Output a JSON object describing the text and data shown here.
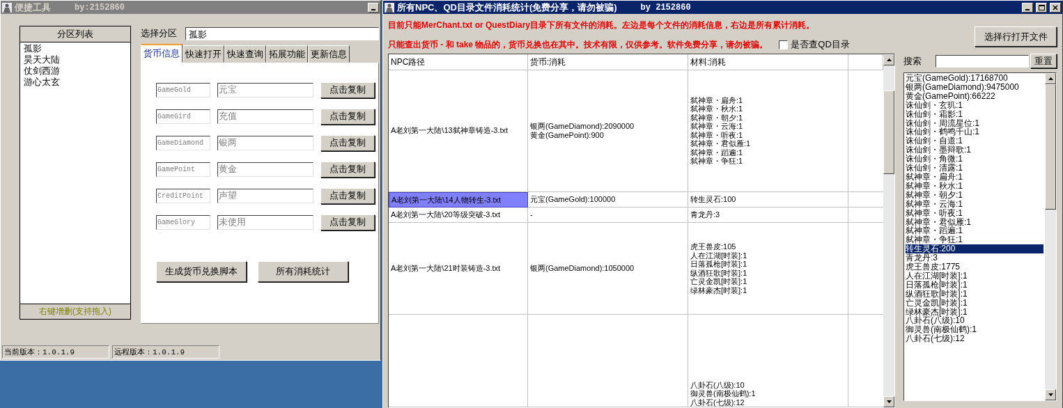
{
  "left_window": {
    "title": "便捷工具",
    "author": "by:2152860",
    "partition_list": {
      "header": "分区列表",
      "items": [
        "孤影",
        "昊天大陆",
        "仗剑西游",
        "游心太玄"
      ],
      "footer": "右键增删(支持拖入)"
    },
    "select_label": "选择分区",
    "select_value": "孤影",
    "tabs": [
      {
        "label": "货币信息",
        "selected": true
      },
      {
        "label": "快速打开",
        "selected": false
      },
      {
        "label": "快速查询",
        "selected": false
      },
      {
        "label": "拓展功能",
        "selected": false
      },
      {
        "label": "更新信息",
        "selected": false
      }
    ],
    "currency_rows": [
      {
        "code": "GameGold",
        "name": "元宝",
        "button": "点击复制"
      },
      {
        "code": "GameGird",
        "name": "充值",
        "button": "点击复制"
      },
      {
        "code": "GameDiamond",
        "name": "银两",
        "button": "点击复制"
      },
      {
        "code": "GamePoint",
        "name": "黄金",
        "button": "点击复制"
      },
      {
        "code": "CreditPoint",
        "name": "声望",
        "button": "点击复制"
      },
      {
        "code": "GameGlory",
        "name": "未使用",
        "button": "点击复制"
      }
    ],
    "action_buttons": [
      "生成货币兑换脚本",
      "所有消耗统计"
    ],
    "status_bar": [
      "当前版本：1.0.1.9",
      "远程版本：1.0.1.9"
    ]
  },
  "right_window": {
    "title": "所有NPC、QD目录文件消耗统计(免费分享，请勿被骗)",
    "author": "by 2152860",
    "notice_lines": [
      "目前只能MerChant.txt or QuestDiary目录下所有文件的消耗。左边是每个文件的消耗信息，右边是所有累计消耗。",
      "只能查出货币 - 和 take 物品的，货币兑换也在其中。技术有限，仅供参考。软件免费分享，请勿被骗。"
    ],
    "qd_checkbox": {
      "label": "是否查QD目录",
      "checked": false
    },
    "open_button": "选择行打开文件",
    "table": {
      "columns": [
        "NPC路径",
        "货币:消耗",
        "材料:消耗"
      ],
      "rows": [
        {
          "path": "A老刘第一大陆\\13弑神章铸造-3.txt",
          "selected": false,
          "currency": [
            "银两(GameDiamond):2090000",
            "黄金(GamePoint):900"
          ],
          "materials": [
            "弑神章・扁舟:1",
            "弑神章・秋水:1",
            "弑神章・朝夕:1",
            "弑神章・云海:1",
            "弑神章・听夜:1",
            "弑神章・君似雁:1",
            "弑神章・蹈遍:1",
            "弑神章・争狂:1"
          ]
        },
        {
          "path": "A老刘第一大陆\\14人物转生-3.txt",
          "selected": true,
          "currency": [
            "元宝(GameGold):100000"
          ],
          "materials": [
            "转生灵石:100"
          ]
        },
        {
          "path": "A老刘第一大陆\\20等级突破-3.txt",
          "selected": false,
          "currency": [
            "-"
          ],
          "materials": [
            "青龙丹:3"
          ]
        },
        {
          "path": "A老刘第一大陆\\21时装铸造-3.txt",
          "selected": false,
          "currency": [
            "银两(GameDiamond):1050000"
          ],
          "materials": [
            "虎王兽皮:105",
            "人在江湖[时装]:1",
            "日落孤枪[时装]:1",
            "纵酒狂歌[时装]:1",
            "亡灵金凯[时装]:1",
            "绿林豪杰[时装]:1"
          ]
        },
        {
          "path": "",
          "selected": false,
          "currency": [],
          "materials": [
            "八卦石(八级):10",
            "御灵兽(南极仙鹤):1",
            "八卦石(七级):12"
          ]
        }
      ]
    },
    "search": {
      "label": "搜索",
      "reset": "重置"
    },
    "totals": [
      {
        "text": "元宝(GameGold):17168700",
        "selected": false
      },
      {
        "text": "银两(GameDiamond):9475000",
        "selected": false
      },
      {
        "text": "黄金(GamePoint):66222",
        "selected": false
      },
      {
        "text": "诛仙剑・玄玑:1",
        "selected": false
      },
      {
        "text": "诛仙剑・霜影:1",
        "selected": false
      },
      {
        "text": "诛仙剑・周流星位:1",
        "selected": false
      },
      {
        "text": "诛仙剑・鹤鸣千山:1",
        "selected": false
      },
      {
        "text": "诛仙剑・自道:1",
        "selected": false
      },
      {
        "text": "诛仙剑・墨辩歌:1",
        "selected": false
      },
      {
        "text": "诛仙剑・角微:1",
        "selected": false
      },
      {
        "text": "诛仙剑・清露:1",
        "selected": false
      },
      {
        "text": "弑神章・扁舟:1",
        "selected": false
      },
      {
        "text": "弑神章・秋水:1",
        "selected": false
      },
      {
        "text": "弑神章・朝夕:1",
        "selected": false
      },
      {
        "text": "弑神章・云海:1",
        "selected": false
      },
      {
        "text": "弑神章・听夜:1",
        "selected": false
      },
      {
        "text": "弑神章・君似雁:1",
        "selected": false
      },
      {
        "text": "弑神章・蹈遍:1",
        "selected": false
      },
      {
        "text": "弑神章・争狂:1",
        "selected": false
      },
      {
        "text": "转生灵石:200",
        "selected": true
      },
      {
        "text": "青龙丹:3",
        "selected": false
      },
      {
        "text": "虎王兽皮:1775",
        "selected": false
      },
      {
        "text": "人在江湖[时装]:1",
        "selected": false
      },
      {
        "text": "日落孤枪[时装]:1",
        "selected": false
      },
      {
        "text": "纵酒狂歌[时装]:1",
        "selected": false
      },
      {
        "text": "亡灵金凯[时装]:1",
        "selected": false
      },
      {
        "text": "绿林豪杰[时装]:1",
        "selected": false
      },
      {
        "text": "八卦石(八级):10",
        "selected": false
      },
      {
        "text": "御灵兽(南极仙鹤):1",
        "selected": false
      },
      {
        "text": "八卦石(七级):12",
        "selected": false
      }
    ]
  }
}
